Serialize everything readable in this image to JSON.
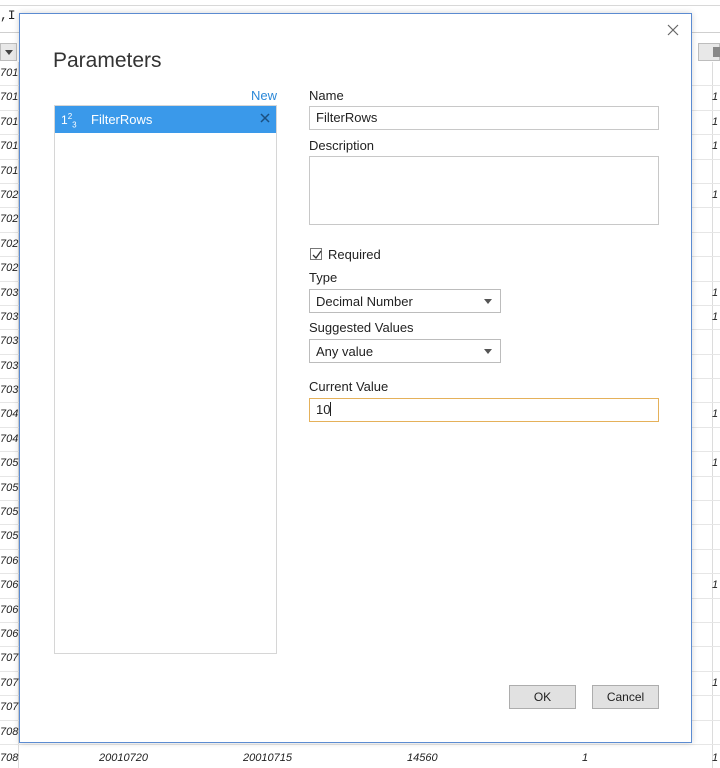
{
  "background": {
    "formula_fragment": ",I",
    "row_left_cells": [
      "701",
      "701",
      "701",
      "701",
      "701",
      "702",
      "702",
      "702",
      "702",
      "703",
      "703",
      "703",
      "703",
      "703",
      "704",
      "704",
      "705",
      "705",
      "705",
      "705",
      "706",
      "706",
      "706",
      "706",
      "707",
      "707",
      "707",
      "708"
    ],
    "row_right_cells": [
      "",
      "1",
      "1",
      "1",
      "",
      "1",
      "",
      "",
      "",
      "1",
      "1",
      "",
      "",
      "",
      "1",
      "",
      "1",
      "",
      "",
      "",
      "",
      "1",
      "",
      "",
      "",
      "1",
      "",
      ""
    ],
    "last_row": {
      "col_a": "708",
      "col_b": "20010720",
      "col_c": "20010715",
      "col_d": "14560",
      "col_e": "1",
      "col_f": "1"
    }
  },
  "dialog": {
    "title": "Parameters",
    "new_link": "New",
    "parameters": [
      {
        "name": "FilterRows",
        "type_icon": "123-icon"
      }
    ],
    "name_label": "Name",
    "name_value": "FilterRows",
    "description_label": "Description",
    "description_value": "",
    "required_label": "Required",
    "required_checked": true,
    "type_label": "Type",
    "type_value": "Decimal Number",
    "suggested_label": "Suggested Values",
    "suggested_value": "Any value",
    "current_label": "Current Value",
    "current_value": "10",
    "ok_label": "OK",
    "cancel_label": "Cancel"
  }
}
